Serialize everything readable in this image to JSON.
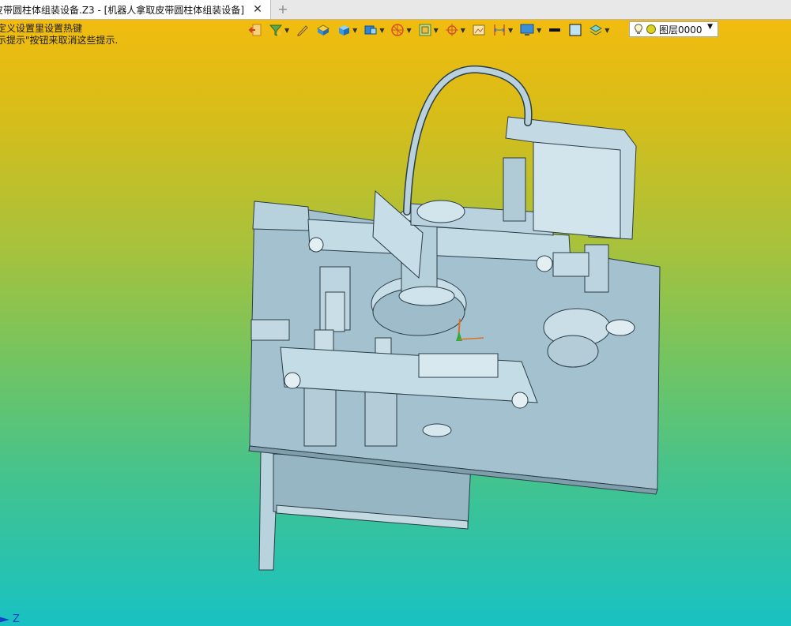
{
  "tab": {
    "title": "皮带圆柱体组装设备.Z3 - [机器人拿取皮带圆柱体组装设备]",
    "close_label": "✕",
    "new_tab_label": "+"
  },
  "hints": {
    "line1": "定义设置里设置热键",
    "line2": "示提示\"按钮来取消这些提示."
  },
  "toolbar": {
    "icons": [
      "exit-icon",
      "filter-icon",
      "pen-icon",
      "layer-box-icon",
      "solid-box-icon",
      "view-cube-icon",
      "wheel-icon",
      "frame-icon",
      "cross-target-icon",
      "picture-icon",
      "dimension-icon",
      "monitor-icon",
      "line-style-icon",
      "color-swatch-icon",
      "layers-stack-icon"
    ],
    "layer_label": "图层0000",
    "accent": "#2a72c8"
  },
  "viewport": {
    "axis_label": "Z",
    "background_top": "#f7bb0c",
    "background_bottom": "#18c1c3",
    "model_color": "#a9c6d4"
  }
}
